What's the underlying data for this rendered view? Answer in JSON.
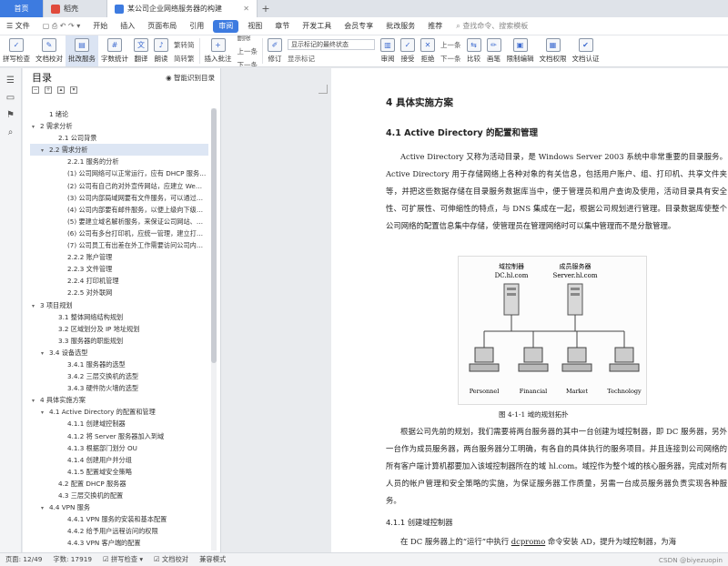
{
  "tabs": {
    "home": "首页",
    "shell": "稻壳",
    "doc": "某公司企业网络服务器的构建"
  },
  "menu": {
    "file": "文件",
    "items": [
      "开始",
      "插入",
      "页面布局",
      "引用",
      "审阅",
      "视图",
      "章节",
      "开发工具",
      "会员专享",
      "批改服务",
      "推荐"
    ],
    "selected": "审阅",
    "search": "查找命令、搜索模板"
  },
  "ribbon": {
    "spell": "拼写检查",
    "proof": "文档校对",
    "batch": "批改服务",
    "count": "字数统计",
    "translate": "翻译",
    "read": "朗读",
    "trad": "繁转简",
    "simp": "简转繁",
    "insert_comment": "插入批注",
    "delete": "删除",
    "prev": "上一条",
    "next": "下一条",
    "revise": "修订",
    "show_mode": "显示标记的最终状态",
    "show_mark": "显示标记",
    "review": "审阅",
    "accept": "接受",
    "reject": "拒绝",
    "prev2": "上一条",
    "next2": "下一条",
    "compare": "比较",
    "pen": "画笔",
    "restrict": "限制编辑",
    "perm": "文档权限",
    "auth": "文档认证"
  },
  "toc": {
    "title": "目录",
    "smart": "智能识别目录",
    "items": [
      {
        "text": "1  绪论",
        "indent": 1,
        "arrow": ""
      },
      {
        "text": "2  需求分析",
        "indent": 0,
        "arrow": "▾"
      },
      {
        "text": "2.1  公司背景",
        "indent": 2,
        "arrow": ""
      },
      {
        "text": "2.2  需求分析",
        "indent": 1,
        "arrow": "▾",
        "active": true
      },
      {
        "text": "2.2.1  服务的分析",
        "indent": 3,
        "arrow": ""
      },
      {
        "text": "(1)  公司网络可以正常运行，应有 DHCP 服务…",
        "indent": 3,
        "arrow": ""
      },
      {
        "text": "(2)  公司有自己的对外宣传网站，应建立 We…",
        "indent": 3,
        "arrow": ""
      },
      {
        "text": "(3)  公司内部局域网要有文件服务，可以通过…",
        "indent": 3,
        "arrow": ""
      },
      {
        "text": "(4)  公司内部要有邮件服务，以便上级向下级…",
        "indent": 3,
        "arrow": ""
      },
      {
        "text": "(5)  要建立域名解析服务，来保证公司网站、…",
        "indent": 3,
        "arrow": ""
      },
      {
        "text": "(6)  公司有多台打印机，应统一管理，建立打印…",
        "indent": 3,
        "arrow": ""
      },
      {
        "text": "(7)  公司员工有出差在外工作需要访问公司内…",
        "indent": 3,
        "arrow": ""
      },
      {
        "text": "2.2.2  账户管理",
        "indent": 3,
        "arrow": ""
      },
      {
        "text": "2.2.3  文件管理",
        "indent": 3,
        "arrow": ""
      },
      {
        "text": "2.2.4  打印机管理",
        "indent": 3,
        "arrow": ""
      },
      {
        "text": "2.2.5  对外联网",
        "indent": 3,
        "arrow": ""
      },
      {
        "text": "3  项目规划",
        "indent": 0,
        "arrow": "▾"
      },
      {
        "text": "3.1  整体网络结构规划",
        "indent": 2,
        "arrow": ""
      },
      {
        "text": "3.2  区域划分及 IP 地址规划",
        "indent": 2,
        "arrow": ""
      },
      {
        "text": "3.3  服务器的职能规划",
        "indent": 2,
        "arrow": ""
      },
      {
        "text": "3.4  设备选型",
        "indent": 1,
        "arrow": "▾"
      },
      {
        "text": "3.4.1  服务器的选型",
        "indent": 3,
        "arrow": ""
      },
      {
        "text": "3.4.2  三层交换机的选型",
        "indent": 3,
        "arrow": ""
      },
      {
        "text": "3.4.3  硬件防火墙的选型",
        "indent": 3,
        "arrow": ""
      },
      {
        "text": "4  具体实施方案",
        "indent": 0,
        "arrow": "▾"
      },
      {
        "text": "4.1  Active Directory 的配置和管理",
        "indent": 1,
        "arrow": "▾"
      },
      {
        "text": "4.1.1  创建域控制器",
        "indent": 3,
        "arrow": ""
      },
      {
        "text": "4.1.2  将 Server 服务器加入到域",
        "indent": 3,
        "arrow": ""
      },
      {
        "text": "4.1.3  根据部门划分 OU",
        "indent": 3,
        "arrow": ""
      },
      {
        "text": "4.1.4  创建用户并分组",
        "indent": 3,
        "arrow": ""
      },
      {
        "text": "4.1.5  配置域安全策略",
        "indent": 3,
        "arrow": ""
      },
      {
        "text": "4.2  配置 DHCP 服务器",
        "indent": 2,
        "arrow": ""
      },
      {
        "text": "4.3  三层交换机的配置",
        "indent": 2,
        "arrow": ""
      },
      {
        "text": "4.4  VPN 服务",
        "indent": 1,
        "arrow": "▾"
      },
      {
        "text": "4.4.1  VPN 服务的安装和基本配置",
        "indent": 3,
        "arrow": ""
      },
      {
        "text": "4.4.2  给予用户远程访问的权限",
        "indent": 3,
        "arrow": ""
      },
      {
        "text": "4.4.3  VPN 客户端的配置",
        "indent": 3,
        "arrow": ""
      }
    ]
  },
  "doc": {
    "h1": "4  具体实施方案",
    "h2": "4.1 Active Directory 的配置和管理",
    "p1": "Active Directory 又称为活动目录，是 Windows Server 2003 系统中非常重要的目录服务。Active Directory 用于存储网络上各种对象的有关信息，包括用户账户、组、打印机、共享文件夹等，并把这些数据存储在目录服务数据库当中，便于管理员和用户查询及使用，活动目录具有安全性、可扩展性、可伸缩性的特点，与 DNS 集成在一起，根据公司规划进行管理。目录数据库使整个公司网络的配置信息集中存储，使管理员在管理网络时可以集中管理而不是分散管理。",
    "figure": {
      "dc_label": "域控制器",
      "dc_name": "DC.hl.com",
      "ms_label": "成员服务器",
      "ms_name": "Server.hl.com",
      "clients": [
        "Personnel",
        "Financial",
        "Market",
        "Technology"
      ]
    },
    "caption": "图 4-1-1  域的规划拓扑",
    "p2": "根据公司先前的规划，我们需要将两台服务器的其中一台创建为域控制器，即 DC 服务器，另外一台作为成员服务器，两台服务器分工明确，有各自的具体执行的服务项目。并且连接到公司网络的所有客户端计算机都要加入该域控制器所在的域 hl.com。域控作为整个域的核心服务器，完成对所有人员的帐户管理和安全策略的实施，为保证服务器工作质量，另需一台成员服务器负责实现各种服务。",
    "h3": "4.1.1 创建域控制器",
    "p3_a": "在 DC 服务器上的“运行”中执行 ",
    "p3_cmd": "dcpromo",
    "p3_b": " 命令安装 AD，提升为域控制器，为海"
  },
  "status": {
    "page": "页面: 12/49",
    "words": "字数: 17919",
    "spell": "拼写检查",
    "proof": "文档校对",
    "compat": "兼容模式",
    "watermark": "CSDN @biyezuopin"
  }
}
